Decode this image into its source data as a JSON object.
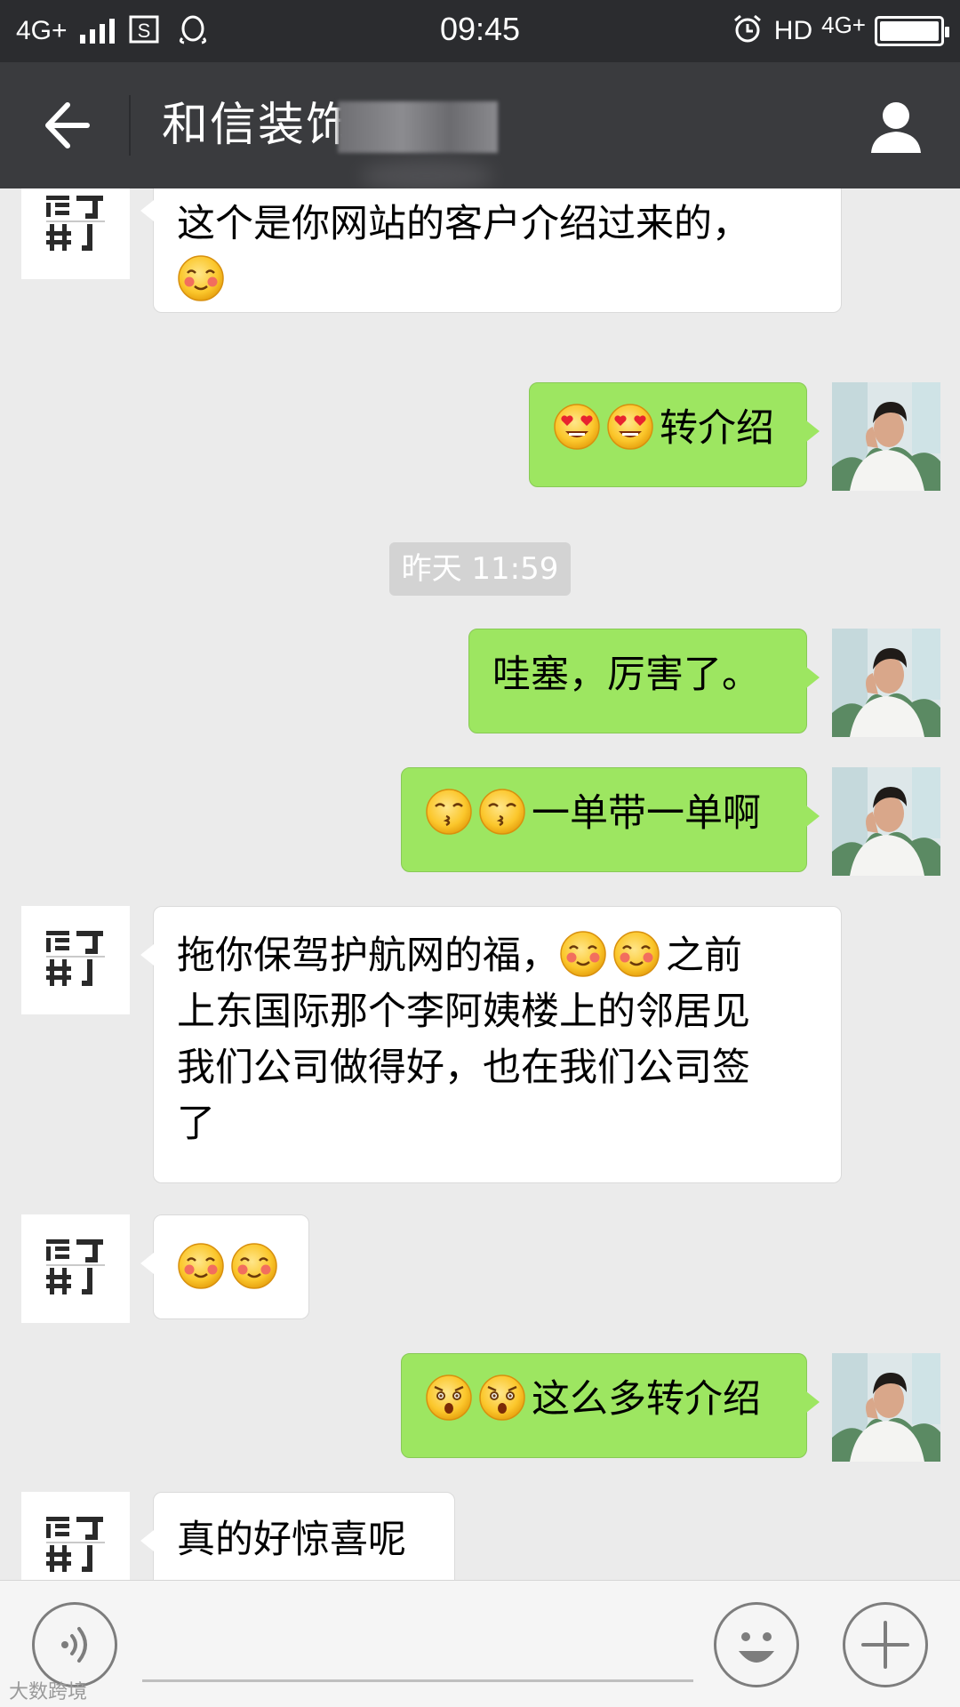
{
  "status_bar": {
    "network": "4G+",
    "time": "09:45",
    "hd_label": "HD",
    "network_right": "4G+",
    "icons": [
      "signal-icon",
      "screenshot-icon",
      "qq-icon",
      "alarm-icon",
      "battery-icon"
    ]
  },
  "header": {
    "title": "和信装饰",
    "icons": [
      "back-arrow-icon",
      "profile-icon"
    ]
  },
  "messages": [
    {
      "side": "in",
      "sender": "brand",
      "text": "这个是你网站的客户介绍过来的，",
      "emojis": [
        "blush-emoji"
      ]
    },
    {
      "side": "out",
      "sender": "me",
      "emojis": [
        "heart-eyes-emoji",
        "heart-eyes-emoji"
      ],
      "text": "转介绍"
    },
    {
      "type": "timestamp",
      "text": "昨天 11:59"
    },
    {
      "side": "out",
      "sender": "me",
      "text": "哇塞，厉害了。"
    },
    {
      "side": "out",
      "sender": "me",
      "emojis": [
        "kiss-emoji",
        "kiss-emoji"
      ],
      "text": "一单带一单啊"
    },
    {
      "side": "in",
      "sender": "brand",
      "text_part1": "拖你保驾护航网的福，",
      "emojis": [
        "blush-emoji",
        "blush-emoji"
      ],
      "text_part2": "之前",
      "text_lines": [
        "上东国际那个李阿姨楼上的邻居见",
        "我们公司做得好，也在我们公司签",
        "了"
      ]
    },
    {
      "side": "in",
      "sender": "brand",
      "emojis": [
        "blush-emoji",
        "blush-emoji"
      ]
    },
    {
      "side": "out",
      "sender": "me",
      "emojis": [
        "shocked-emoji",
        "shocked-emoji"
      ],
      "text": "这么多转介绍"
    },
    {
      "side": "in",
      "sender": "brand",
      "text": "真的好惊喜呢"
    }
  ],
  "avatar_brand_glyphs": [
    "简了",
    "异 J"
  ],
  "input_bar": {
    "icons": [
      "voice-icon",
      "emoji-icon",
      "plus-icon"
    ]
  },
  "watermark": "大数跨境",
  "colors": {
    "status_bar_bg": "#2b2c2f",
    "title_bar_bg": "#3a3b3e",
    "chat_bg": "#ebebeb",
    "outgoing_bubble": "#9de661",
    "incoming_bubble": "#ffffff"
  }
}
